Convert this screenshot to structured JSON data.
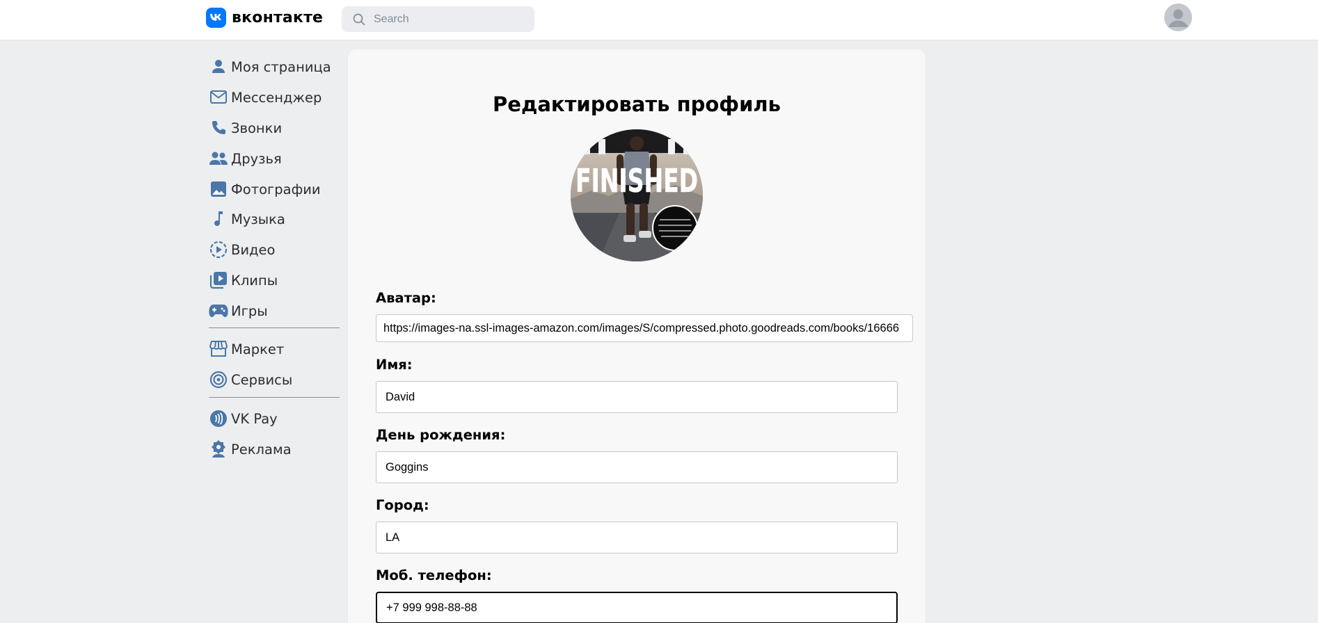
{
  "header": {
    "logo_text": "вконтакте",
    "search_placeholder": "Search"
  },
  "sidebar": {
    "items": [
      {
        "label": "Моя страница",
        "icon": "user-icon"
      },
      {
        "label": "Мессенджер",
        "icon": "mail-icon"
      },
      {
        "label": "Звонки",
        "icon": "phone-icon"
      },
      {
        "label": "Друзья",
        "icon": "friends-icon"
      },
      {
        "label": "Фотографии",
        "icon": "photo-icon"
      },
      {
        "label": "Музыка",
        "icon": "music-note-icon"
      },
      {
        "label": "Видео",
        "icon": "video-play-icon"
      },
      {
        "label": "Клипы",
        "icon": "clips-icon"
      },
      {
        "label": "Игры",
        "icon": "gamepad-icon"
      },
      {
        "label": "Маркет",
        "icon": "store-icon"
      },
      {
        "label": "Сервисы",
        "icon": "services-icon"
      },
      {
        "label": "VK Pay",
        "icon": "vk-pay-icon"
      },
      {
        "label": "Реклама",
        "icon": "ads-icon"
      }
    ]
  },
  "main": {
    "title": "Редактировать профиль",
    "photo_text": "FINISHED",
    "fields": {
      "avatar": {
        "label": "Аватар:",
        "value": "https://images-na.ssl-images-amazon.com/images/S/compressed.photo.goodreads.com/books/16666"
      },
      "name": {
        "label": "Имя:",
        "value": "David"
      },
      "birthday": {
        "label": "День рождения:",
        "value": "Goggins"
      },
      "city": {
        "label": "Город:",
        "value": "LA"
      },
      "phone": {
        "label": "Моб. телефон:",
        "value": "+7 999 998-88-88"
      }
    }
  },
  "colors": {
    "accent": "#0077ff",
    "icon": "#4a76a8",
    "background": "#edeef0",
    "card": "#f8f8f8"
  }
}
